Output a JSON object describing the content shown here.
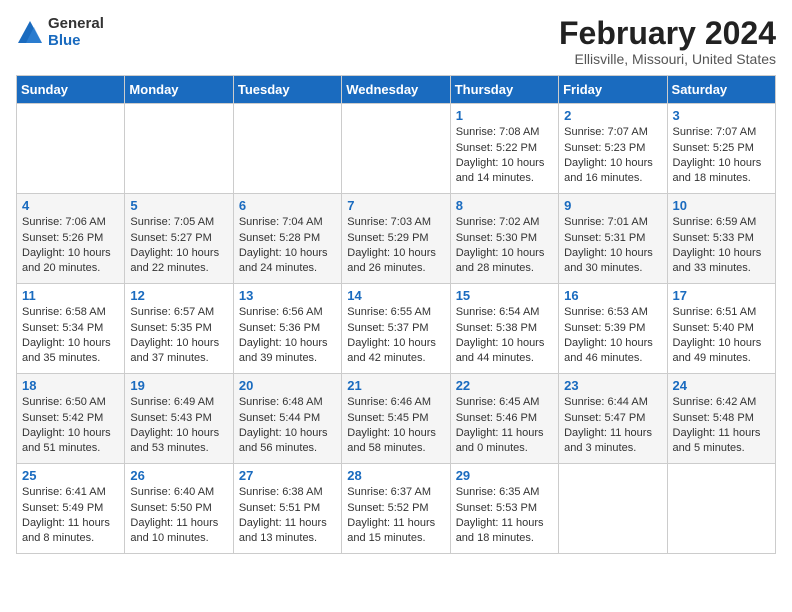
{
  "header": {
    "logo_general": "General",
    "logo_blue": "Blue",
    "month_year": "February 2024",
    "location": "Ellisville, Missouri, United States"
  },
  "days_of_week": [
    "Sunday",
    "Monday",
    "Tuesday",
    "Wednesday",
    "Thursday",
    "Friday",
    "Saturday"
  ],
  "weeks": [
    [
      {
        "day": "",
        "content": ""
      },
      {
        "day": "",
        "content": ""
      },
      {
        "day": "",
        "content": ""
      },
      {
        "day": "",
        "content": ""
      },
      {
        "day": "1",
        "content": "Sunrise: 7:08 AM\nSunset: 5:22 PM\nDaylight: 10 hours and 14 minutes."
      },
      {
        "day": "2",
        "content": "Sunrise: 7:07 AM\nSunset: 5:23 PM\nDaylight: 10 hours and 16 minutes."
      },
      {
        "day": "3",
        "content": "Sunrise: 7:07 AM\nSunset: 5:25 PM\nDaylight: 10 hours and 18 minutes."
      }
    ],
    [
      {
        "day": "4",
        "content": "Sunrise: 7:06 AM\nSunset: 5:26 PM\nDaylight: 10 hours and 20 minutes."
      },
      {
        "day": "5",
        "content": "Sunrise: 7:05 AM\nSunset: 5:27 PM\nDaylight: 10 hours and 22 minutes."
      },
      {
        "day": "6",
        "content": "Sunrise: 7:04 AM\nSunset: 5:28 PM\nDaylight: 10 hours and 24 minutes."
      },
      {
        "day": "7",
        "content": "Sunrise: 7:03 AM\nSunset: 5:29 PM\nDaylight: 10 hours and 26 minutes."
      },
      {
        "day": "8",
        "content": "Sunrise: 7:02 AM\nSunset: 5:30 PM\nDaylight: 10 hours and 28 minutes."
      },
      {
        "day": "9",
        "content": "Sunrise: 7:01 AM\nSunset: 5:31 PM\nDaylight: 10 hours and 30 minutes."
      },
      {
        "day": "10",
        "content": "Sunrise: 6:59 AM\nSunset: 5:33 PM\nDaylight: 10 hours and 33 minutes."
      }
    ],
    [
      {
        "day": "11",
        "content": "Sunrise: 6:58 AM\nSunset: 5:34 PM\nDaylight: 10 hours and 35 minutes."
      },
      {
        "day": "12",
        "content": "Sunrise: 6:57 AM\nSunset: 5:35 PM\nDaylight: 10 hours and 37 minutes."
      },
      {
        "day": "13",
        "content": "Sunrise: 6:56 AM\nSunset: 5:36 PM\nDaylight: 10 hours and 39 minutes."
      },
      {
        "day": "14",
        "content": "Sunrise: 6:55 AM\nSunset: 5:37 PM\nDaylight: 10 hours and 42 minutes."
      },
      {
        "day": "15",
        "content": "Sunrise: 6:54 AM\nSunset: 5:38 PM\nDaylight: 10 hours and 44 minutes."
      },
      {
        "day": "16",
        "content": "Sunrise: 6:53 AM\nSunset: 5:39 PM\nDaylight: 10 hours and 46 minutes."
      },
      {
        "day": "17",
        "content": "Sunrise: 6:51 AM\nSunset: 5:40 PM\nDaylight: 10 hours and 49 minutes."
      }
    ],
    [
      {
        "day": "18",
        "content": "Sunrise: 6:50 AM\nSunset: 5:42 PM\nDaylight: 10 hours and 51 minutes."
      },
      {
        "day": "19",
        "content": "Sunrise: 6:49 AM\nSunset: 5:43 PM\nDaylight: 10 hours and 53 minutes."
      },
      {
        "day": "20",
        "content": "Sunrise: 6:48 AM\nSunset: 5:44 PM\nDaylight: 10 hours and 56 minutes."
      },
      {
        "day": "21",
        "content": "Sunrise: 6:46 AM\nSunset: 5:45 PM\nDaylight: 10 hours and 58 minutes."
      },
      {
        "day": "22",
        "content": "Sunrise: 6:45 AM\nSunset: 5:46 PM\nDaylight: 11 hours and 0 minutes."
      },
      {
        "day": "23",
        "content": "Sunrise: 6:44 AM\nSunset: 5:47 PM\nDaylight: 11 hours and 3 minutes."
      },
      {
        "day": "24",
        "content": "Sunrise: 6:42 AM\nSunset: 5:48 PM\nDaylight: 11 hours and 5 minutes."
      }
    ],
    [
      {
        "day": "25",
        "content": "Sunrise: 6:41 AM\nSunset: 5:49 PM\nDaylight: 11 hours and 8 minutes."
      },
      {
        "day": "26",
        "content": "Sunrise: 6:40 AM\nSunset: 5:50 PM\nDaylight: 11 hours and 10 minutes."
      },
      {
        "day": "27",
        "content": "Sunrise: 6:38 AM\nSunset: 5:51 PM\nDaylight: 11 hours and 13 minutes."
      },
      {
        "day": "28",
        "content": "Sunrise: 6:37 AM\nSunset: 5:52 PM\nDaylight: 11 hours and 15 minutes."
      },
      {
        "day": "29",
        "content": "Sunrise: 6:35 AM\nSunset: 5:53 PM\nDaylight: 11 hours and 18 minutes."
      },
      {
        "day": "",
        "content": ""
      },
      {
        "day": "",
        "content": ""
      }
    ]
  ]
}
